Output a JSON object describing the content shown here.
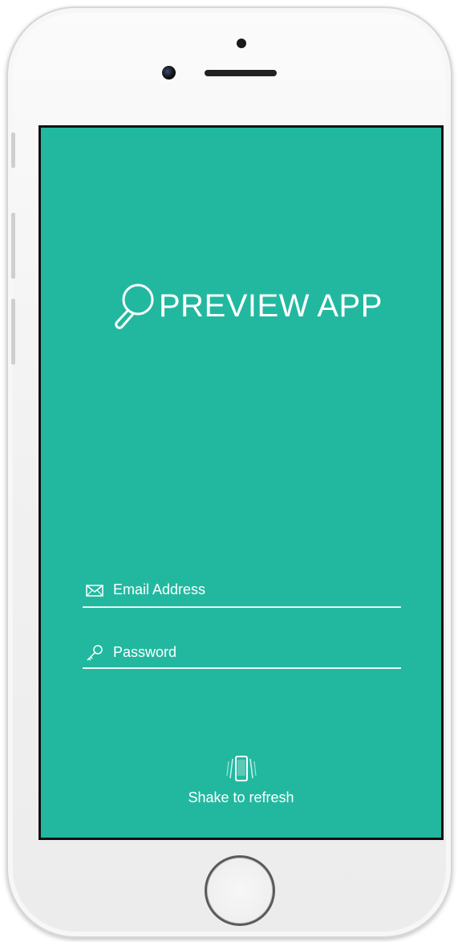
{
  "app": {
    "logo_text": "PREVIEW APP",
    "logo_icon": "magnifier-icon"
  },
  "login": {
    "email": {
      "placeholder": "Email Address",
      "value": "",
      "icon": "envelope-icon"
    },
    "password": {
      "placeholder": "Password",
      "value": "",
      "icon": "key-icon"
    }
  },
  "footer": {
    "shake_label": "Shake to refresh",
    "shake_icon": "shake-phone-icon"
  },
  "colors": {
    "screen_background": "#22b8a0",
    "text": "#ffffff",
    "device_body": "#f3f3f3"
  }
}
